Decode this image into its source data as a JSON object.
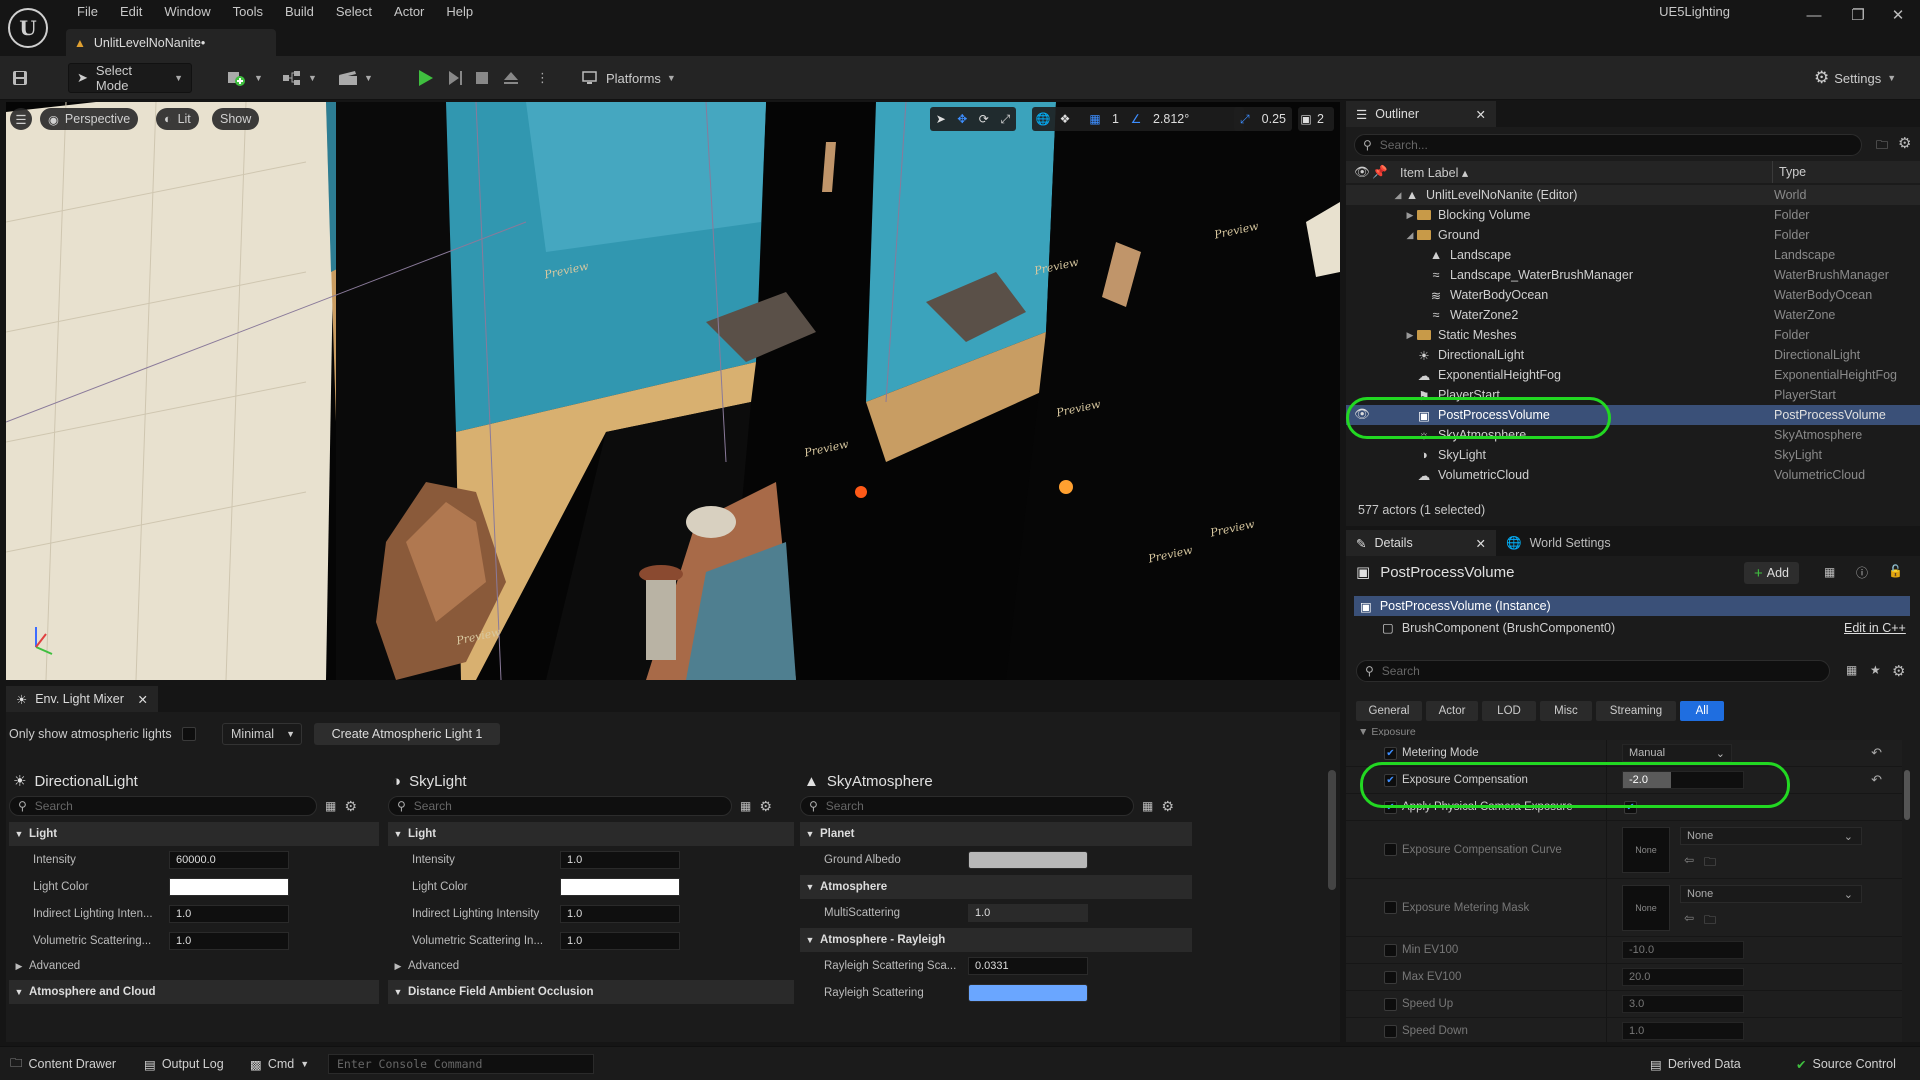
{
  "app": {
    "menus": [
      "File",
      "Edit",
      "Window",
      "Tools",
      "Build",
      "Select",
      "Actor",
      "Help"
    ],
    "project_name": "UE5Lighting",
    "doc_tab": "UnlitLevelNoNanite•"
  },
  "toolbar": {
    "select_mode": "Select Mode",
    "platforms": "Platforms",
    "settings": "Settings"
  },
  "viewport": {
    "view_mode": "Perspective",
    "lit": "Lit",
    "show": "Show",
    "grid_count": "1",
    "angle_snap": "2.812°",
    "scale_snap": "0.25",
    "camera_speed": "2",
    "preview_label": "Preview"
  },
  "outliner": {
    "tab": "Outliner",
    "search_placeholder": "Search...",
    "col_label": "Item Label ▴",
    "col_type": "Type",
    "rows": [
      {
        "label": "UnlitLevelNoNanite (Editor)",
        "type": "World"
      },
      {
        "label": "Blocking Volume",
        "type": "Folder"
      },
      {
        "label": "Ground",
        "type": "Folder"
      },
      {
        "label": "Landscape",
        "type": "Landscape"
      },
      {
        "label": "Landscape_WaterBrushManager",
        "type": "WaterBrushManager"
      },
      {
        "label": "WaterBodyOcean",
        "type": "WaterBodyOcean"
      },
      {
        "label": "WaterZone2",
        "type": "WaterZone"
      },
      {
        "label": "Static Meshes",
        "type": "Folder"
      },
      {
        "label": "DirectionalLight",
        "type": "DirectionalLight"
      },
      {
        "label": "ExponentialHeightFog",
        "type": "ExponentialHeightFog"
      },
      {
        "label": "PlayerStart",
        "type": "PlayerStart"
      },
      {
        "label": "PostProcessVolume",
        "type": "PostProcessVolume"
      },
      {
        "label": "SkyAtmosphere",
        "type": "SkyAtmosphere"
      },
      {
        "label": "SkyLight",
        "type": "SkyLight"
      },
      {
        "label": "VolumetricCloud",
        "type": "VolumetricCloud"
      }
    ],
    "status": "577 actors (1 selected)"
  },
  "details": {
    "tab": "Details",
    "tab2": "World Settings",
    "actor_name": "PostProcessVolume",
    "add_label": "Add",
    "instance": "PostProcessVolume (Instance)",
    "component": "BrushComponent (BrushComponent0)",
    "edit_link": "Edit in C++",
    "search_placeholder": "Search",
    "filters": [
      "General",
      "Actor",
      "LOD",
      "Misc",
      "Streaming",
      "All"
    ],
    "section": "Exposure",
    "props": {
      "metering_mode": {
        "label": "Metering Mode",
        "value": "Manual"
      },
      "exposure_comp": {
        "label": "Exposure Compensation",
        "value": "-2.0"
      },
      "apply_physical": {
        "label": "Apply Physical Camera Exposure"
      },
      "exposure_curve": {
        "label": "Exposure Compensation Curve",
        "thumb": "None",
        "value": "None"
      },
      "metering_mask": {
        "label": "Exposure Metering Mask",
        "thumb": "None",
        "value": "None"
      },
      "min_ev": {
        "label": "Min EV100",
        "value": "-10.0"
      },
      "max_ev": {
        "label": "Max EV100",
        "value": "20.0"
      },
      "speed_up": {
        "label": "Speed Up",
        "value": "3.0"
      },
      "speed_down": {
        "label": "Speed Down",
        "value": "1.0"
      }
    }
  },
  "mixer": {
    "tab": "Env. Light Mixer",
    "only_show": "Only show atmospheric lights",
    "mode": "Minimal",
    "create_btn": "Create Atmospheric Light 1",
    "search_placeholder": "Search",
    "directional": {
      "title": "DirectionalLight",
      "section": "Light",
      "intensity_label": "Intensity",
      "intensity": "60000.0",
      "color_label": "Light Color",
      "indirect_label": "Indirect Lighting Inten...",
      "indirect": "1.0",
      "volumetric_label": "Volumetric Scattering...",
      "volumetric": "1.0",
      "advanced": "Advanced",
      "section2": "Atmosphere and Cloud"
    },
    "skylight": {
      "title": "SkyLight",
      "section": "Light",
      "intensity_label": "Intensity",
      "intensity": "1.0",
      "color_label": "Light Color",
      "indirect_label": "Indirect Lighting Intensity",
      "indirect": "1.0",
      "volumetric_label": "Volumetric Scattering In...",
      "volumetric": "1.0",
      "advanced": "Advanced",
      "section2": "Distance Field Ambient Occlusion"
    },
    "atmosphere": {
      "title": "SkyAtmosphere",
      "section": "Planet",
      "albedo_label": "Ground Albedo",
      "section2": "Atmosphere",
      "multi_label": "MultiScattering",
      "multi": "1.0",
      "section3": "Atmosphere - Rayleigh",
      "rayleigh_sca_label": "Rayleigh Scattering Sca...",
      "rayleigh_sca": "0.0331",
      "rayleigh_label": "Rayleigh Scattering"
    }
  },
  "statusbar": {
    "content_drawer": "Content Drawer",
    "output_log": "Output Log",
    "cmd": "Cmd",
    "console_placeholder": "Enter Console Command",
    "derived_data": "Derived Data",
    "source_control": "Source Control"
  },
  "colors": {
    "accent_blue": "#1f6ee0",
    "selection": "#3a5078",
    "highlight_ring": "#22d822",
    "play_green": "#3fbf3f"
  }
}
